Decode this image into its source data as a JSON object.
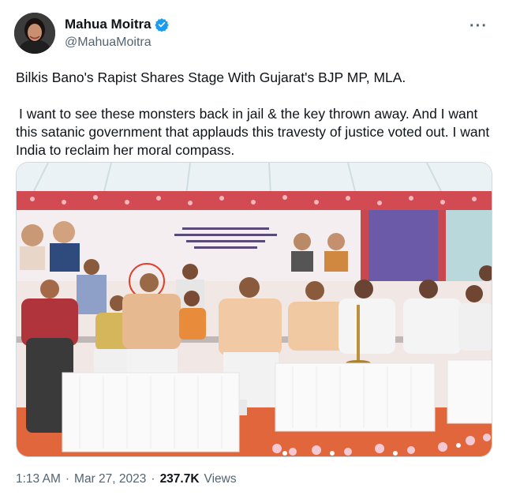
{
  "author": {
    "display_name": "Mahua Moitra",
    "handle": "@MahuaMoitra",
    "verified_color": "#1d9bf0"
  },
  "more_menu": "···",
  "tweet": {
    "line1": "Bilkis Bano's Rapist Shares Stage With Gujarat's BJP MP, MLA.",
    "line2": "I want to see these monsters back in jail & the key thrown away. And I want this satanic government that applauds this travesty of justice voted out. I want India to reclaim her moral compass."
  },
  "meta": {
    "time": "1:13 AM",
    "separator": "·",
    "date": "Mar 27, 2023",
    "views_count": "237.7K",
    "views_label": "Views"
  },
  "colors": {
    "text": "#0f1419",
    "secondary": "#536471",
    "border": "#cfd9de"
  }
}
